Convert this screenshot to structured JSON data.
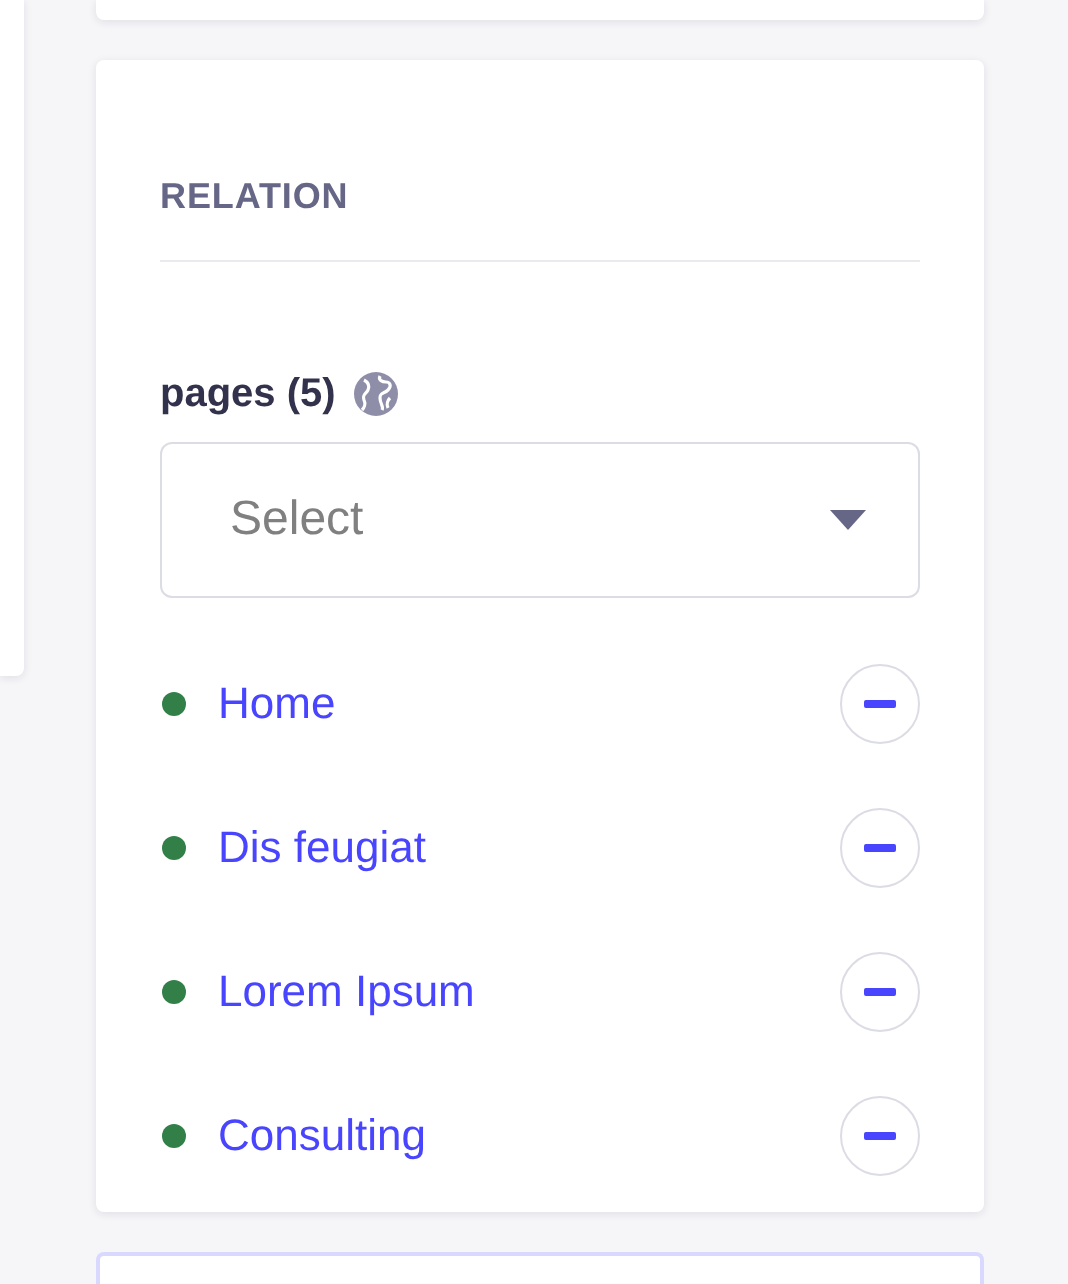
{
  "section": {
    "title": "RELATION"
  },
  "field": {
    "label": "pages (5)",
    "placeholder": "Select"
  },
  "items": [
    {
      "label": "Home",
      "color": "#328048"
    },
    {
      "label": "Dis feugiat",
      "color": "#328048"
    },
    {
      "label": "Lorem Ipsum",
      "color": "#328048"
    },
    {
      "label": "Consulting",
      "color": "#328048"
    }
  ]
}
